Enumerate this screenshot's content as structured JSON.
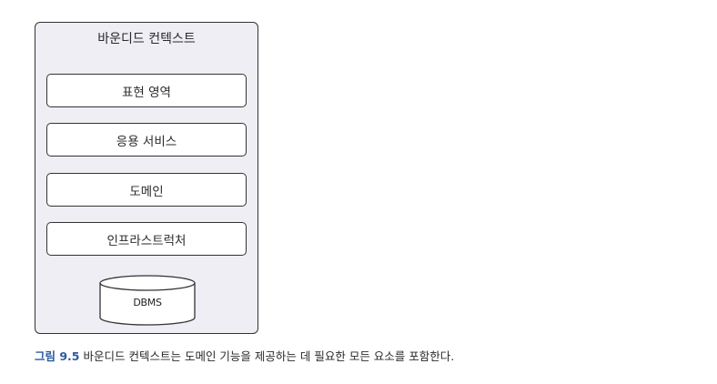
{
  "diagram": {
    "context_title": "바운디드 컨텍스트",
    "layers": [
      {
        "label": "표현 영역"
      },
      {
        "label": "응용 서비스"
      },
      {
        "label": "도메인"
      },
      {
        "label": "인프라스트럭처"
      }
    ],
    "database_label": "DBMS"
  },
  "caption": {
    "figure_label": "그림 9.5",
    "text": "바운디드 컨텍스트는 도메인 기능을 제공하는 데 필요한 모든 요소를 포함한다."
  },
  "colors": {
    "context_fill": "#eeeef4",
    "border": "#333333",
    "figure_label": "#2c5aa0"
  }
}
